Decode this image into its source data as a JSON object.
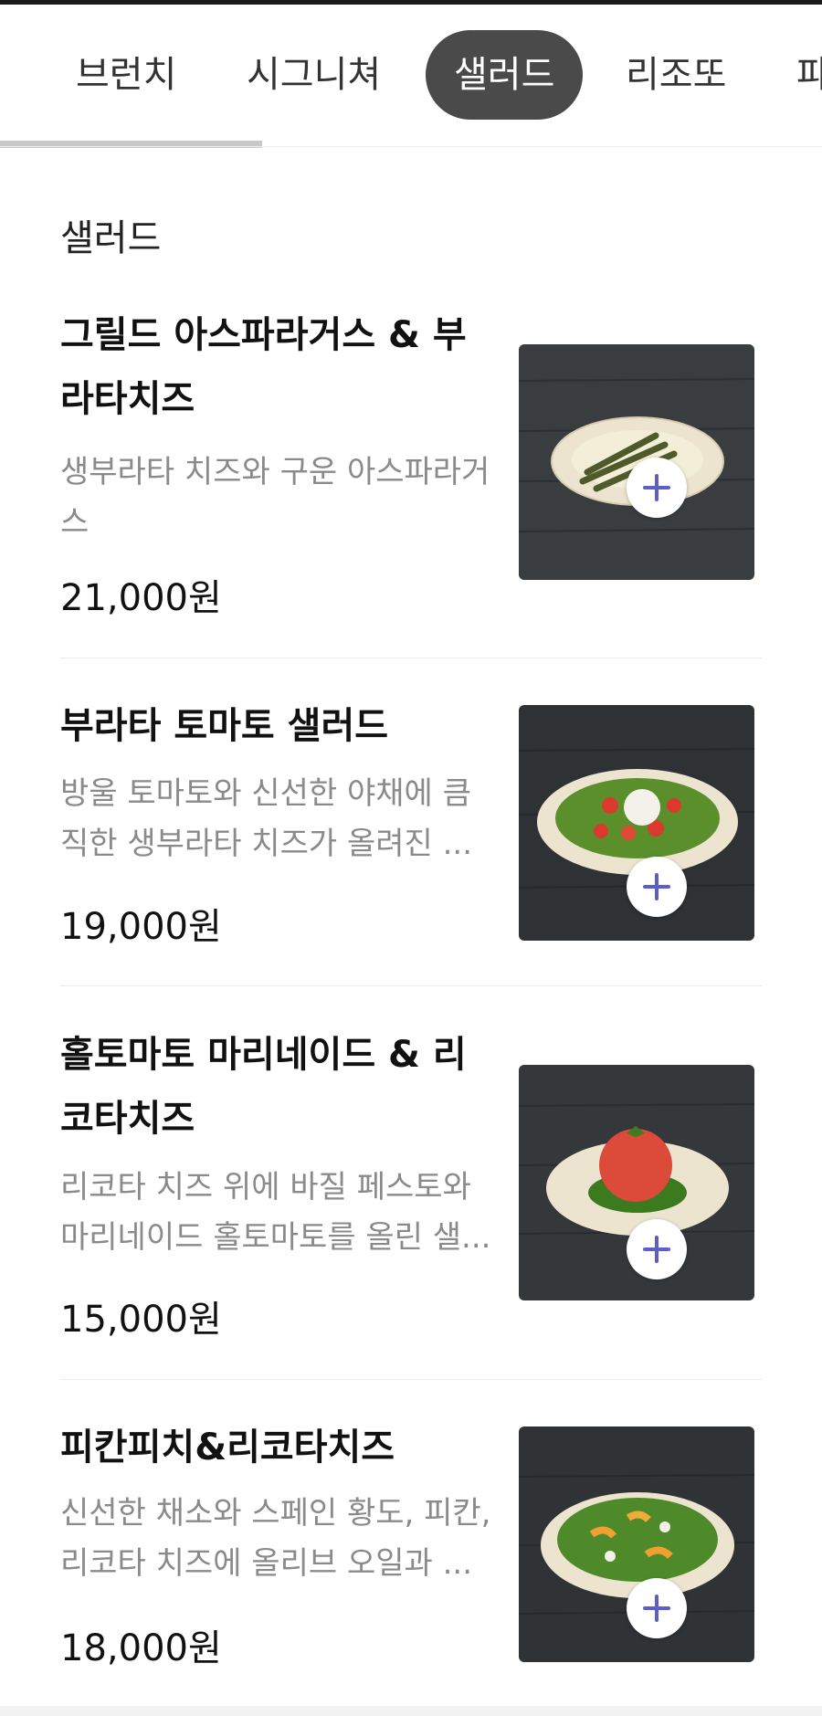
{
  "tabs": [
    {
      "label": "브런치",
      "active": false
    },
    {
      "label": "시그니쳐",
      "active": false
    },
    {
      "label": "샐러드",
      "active": true
    },
    {
      "label": "리조또",
      "active": false
    },
    {
      "label": "파",
      "active": false
    }
  ],
  "section": {
    "title": "샐러드"
  },
  "items": [
    {
      "name": "그릴드 아스파라거스 & 부라타치즈",
      "description": "생부라타 치즈와 구운 아스파라거스",
      "price": "21,000원",
      "image": "grilled-asparagus-burrata-photo",
      "add_icon": "plus-icon"
    },
    {
      "name": "부라타 토마토 샐러드",
      "description_lines": [
        "방울 토마토와 신선한 야채에 큼",
        "직한 생부라타 치즈가 올려진 ..."
      ],
      "price": "19,000원",
      "image": "burrata-tomato-salad-photo",
      "add_icon": "plus-icon"
    },
    {
      "name": "홀토마토 마리네이드 & 리코타치즈",
      "description_lines": [
        "리코타 치즈 위에 바질 페스토와",
        "마리네이드 홀토마토를 올린 샐..."
      ],
      "price": "15,000원",
      "image": "whole-tomato-ricotta-photo",
      "add_icon": "plus-icon"
    },
    {
      "name": "피칸피치&리코타치즈",
      "description_lines": [
        "신선한 채소와 스페인 황도, 피칸,",
        "리코타 치즈에 올리브 오일과 ..."
      ],
      "price": "18,000원",
      "image": "pecan-peach-ricotta-photo",
      "add_icon": "plus-icon"
    }
  ],
  "colors": {
    "active_tab_bg": "#4a4a4a",
    "plus_icon": "#5b5fc7",
    "description_text": "#8a8a8a"
  }
}
